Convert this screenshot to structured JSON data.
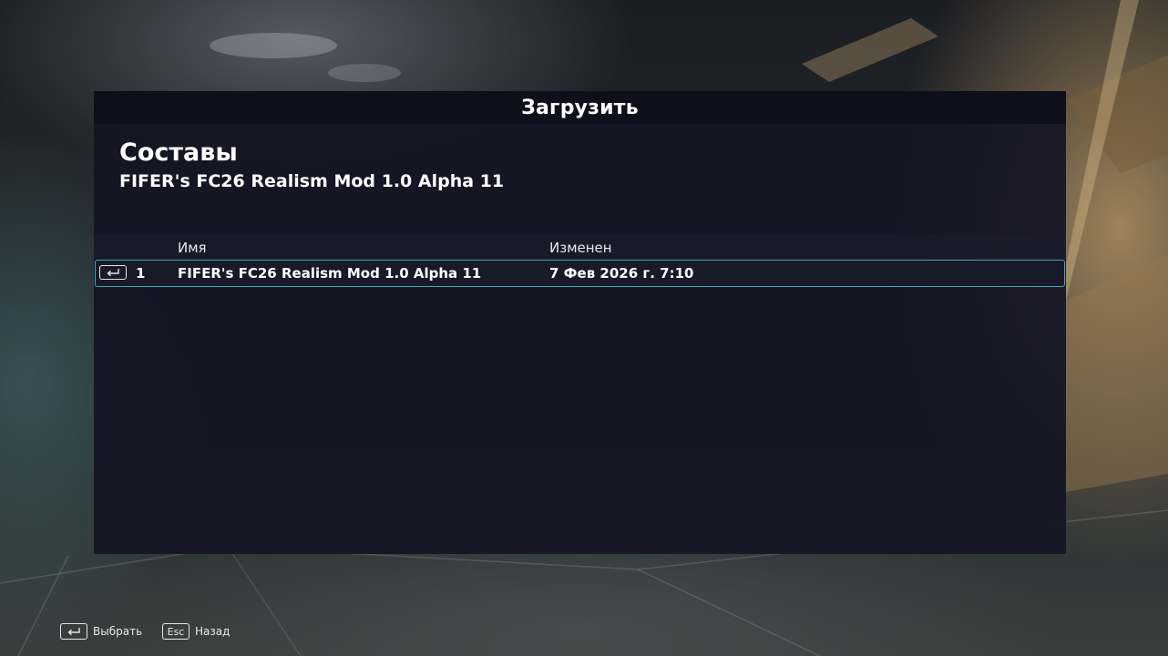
{
  "dialog": {
    "title": "Загрузить",
    "section_title": "Составы",
    "section_subtitle": "FIFER's FC26 Realism Mod 1.0 Alpha 11"
  },
  "table": {
    "headers": {
      "name": "Имя",
      "modified": "Изменен"
    },
    "rows": [
      {
        "index": "1",
        "name": "FIFER's FC26 Realism Mod 1.0 Alpha 11",
        "modified": "7 Фев 2026 г. 7:10",
        "key_icon": "enter-key-icon"
      }
    ],
    "selected_row_border": "#3fa9b3"
  },
  "footer": {
    "select": {
      "key_icon": "enter-key-icon",
      "label": "Выбрать"
    },
    "back": {
      "key": "Esc",
      "label": "Назад"
    }
  },
  "colors": {
    "dialog_bg": "#141424",
    "accent": "#3fa9b3",
    "text": "#ffffff"
  }
}
